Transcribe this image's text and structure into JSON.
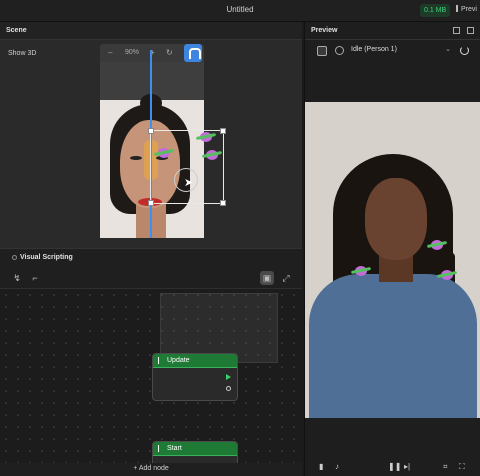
{
  "window": {
    "title": "Untitled",
    "file_size": "0.1 MB",
    "preview_tab_label": "Previ"
  },
  "scene": {
    "header_label": "Scene",
    "show3d_label": "Show 3D",
    "zoom": {
      "minus": "–",
      "value": "90%",
      "plus": "+",
      "reset_icon": "reset-icon"
    },
    "camera_button_icon": "magnet-icon"
  },
  "visual_scripting": {
    "header_label": "Visual Scripting",
    "tools": [
      "curve-tool-icon",
      "branch-tool-icon",
      "layout-icon",
      "fit-icon"
    ],
    "nodes": [
      {
        "label": "Update"
      },
      {
        "label": "Start"
      }
    ],
    "add_node_label": "+ Add node"
  },
  "preview": {
    "header_label": "Preview",
    "animation_select": {
      "value": "Idle (Person 1)"
    },
    "colors": {
      "accent": "#3d85e0",
      "node_green": "#1f7a35",
      "size_green": "#3ed17a"
    }
  }
}
